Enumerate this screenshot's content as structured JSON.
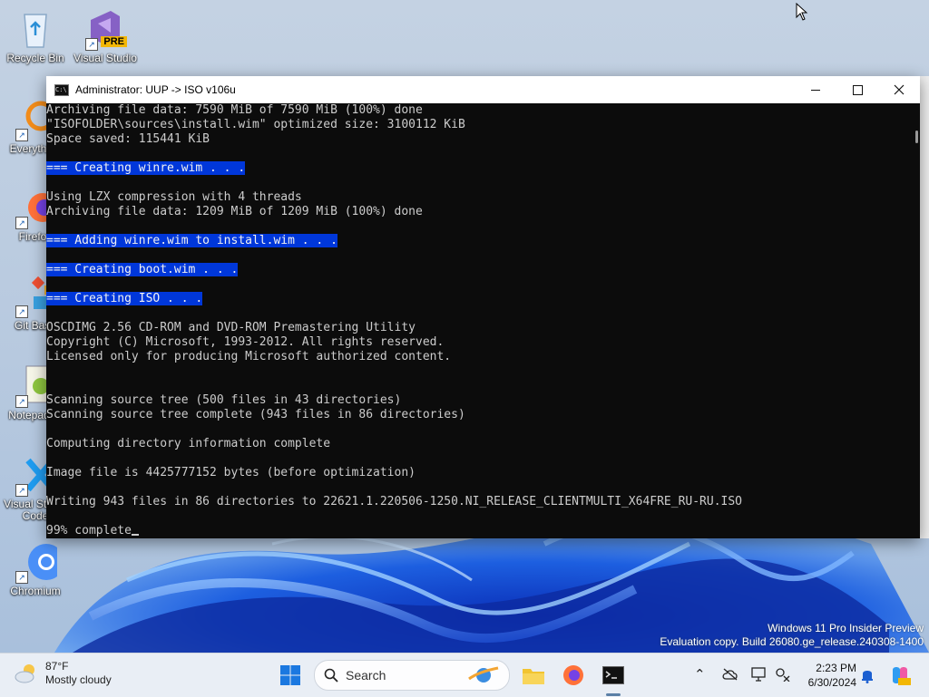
{
  "desktop": {
    "icons": [
      {
        "label": "Recycle Bin"
      },
      {
        "label": "Visual Studio 2022 Preview",
        "badge": "PRE"
      },
      {
        "label": "Everything"
      },
      {
        "label": "Firefox"
      },
      {
        "label": "Git Bash"
      },
      {
        "label": "Notepad++"
      },
      {
        "label": "Visual Studio Code"
      },
      {
        "label": "Chromium"
      }
    ],
    "watermark": {
      "line1": "Windows 11 Pro Insider Preview",
      "line2": "Evaluation copy. Build 26080.ge_release.240308-1400"
    }
  },
  "window": {
    "title": "Administrator:  UUP -> ISO v106u",
    "minimize_icon": "minimize-icon",
    "maximize_icon": "maximize-icon",
    "close_icon": "close-icon",
    "console_lines": [
      {
        "text": "Archiving file data: 7590 MiB of 7590 MiB (100%) done",
        "highlight": false
      },
      {
        "text": "\"ISOFOLDER\\sources\\install.wim\" optimized size: 3100112 KiB",
        "highlight": false
      },
      {
        "text": "Space saved: 115441 KiB",
        "highlight": false
      },
      {
        "text": "",
        "highlight": false
      },
      {
        "text": "=== Creating winre.wim . . .",
        "highlight": true
      },
      {
        "text": "",
        "highlight": false
      },
      {
        "text": "Using LZX compression with 4 threads",
        "highlight": false
      },
      {
        "text": "Archiving file data: 1209 MiB of 1209 MiB (100%) done",
        "highlight": false
      },
      {
        "text": "",
        "highlight": false
      },
      {
        "text": "=== Adding winre.wim to install.wim . . .",
        "highlight": true
      },
      {
        "text": "",
        "highlight": false
      },
      {
        "text": "=== Creating boot.wim . . .",
        "highlight": true
      },
      {
        "text": "",
        "highlight": false
      },
      {
        "text": "=== Creating ISO . . .",
        "highlight": true
      },
      {
        "text": "",
        "highlight": false
      },
      {
        "text": "OSCDIMG 2.56 CD-ROM and DVD-ROM Premastering Utility",
        "highlight": false
      },
      {
        "text": "Copyright (C) Microsoft, 1993-2012. All rights reserved.",
        "highlight": false
      },
      {
        "text": "Licensed only for producing Microsoft authorized content.",
        "highlight": false
      },
      {
        "text": "",
        "highlight": false
      },
      {
        "text": "",
        "highlight": false
      },
      {
        "text": "Scanning source tree (500 files in 43 directories)",
        "highlight": false
      },
      {
        "text": "Scanning source tree complete (943 files in 86 directories)",
        "highlight": false
      },
      {
        "text": "",
        "highlight": false
      },
      {
        "text": "Computing directory information complete",
        "highlight": false
      },
      {
        "text": "",
        "highlight": false
      },
      {
        "text": "Image file is 4425777152 bytes (before optimization)",
        "highlight": false
      },
      {
        "text": "",
        "highlight": false
      },
      {
        "text": "Writing 943 files in 86 directories to 22621.1.220506-1250.NI_RELEASE_CLIENTMULTI_X64FRE_RU-RU.ISO",
        "highlight": false
      },
      {
        "text": "",
        "highlight": false
      },
      {
        "text": "99% complete",
        "highlight": false,
        "cursor": true
      }
    ]
  },
  "taskbar": {
    "weather": {
      "temp": "87°F",
      "condition": "Mostly cloudy"
    },
    "search_label": "Search",
    "apps": [
      "windows-start-icon",
      "file-explorer-icon",
      "firefox-icon",
      "terminal-icon"
    ],
    "clock": {
      "time": "2:23 PM",
      "date": "6/30/2024"
    },
    "colors": {
      "highlight_bg": "#0037da",
      "console_bg": "#0c0c0c",
      "console_fg": "#cccccc",
      "accent": "#0078d4"
    }
  }
}
